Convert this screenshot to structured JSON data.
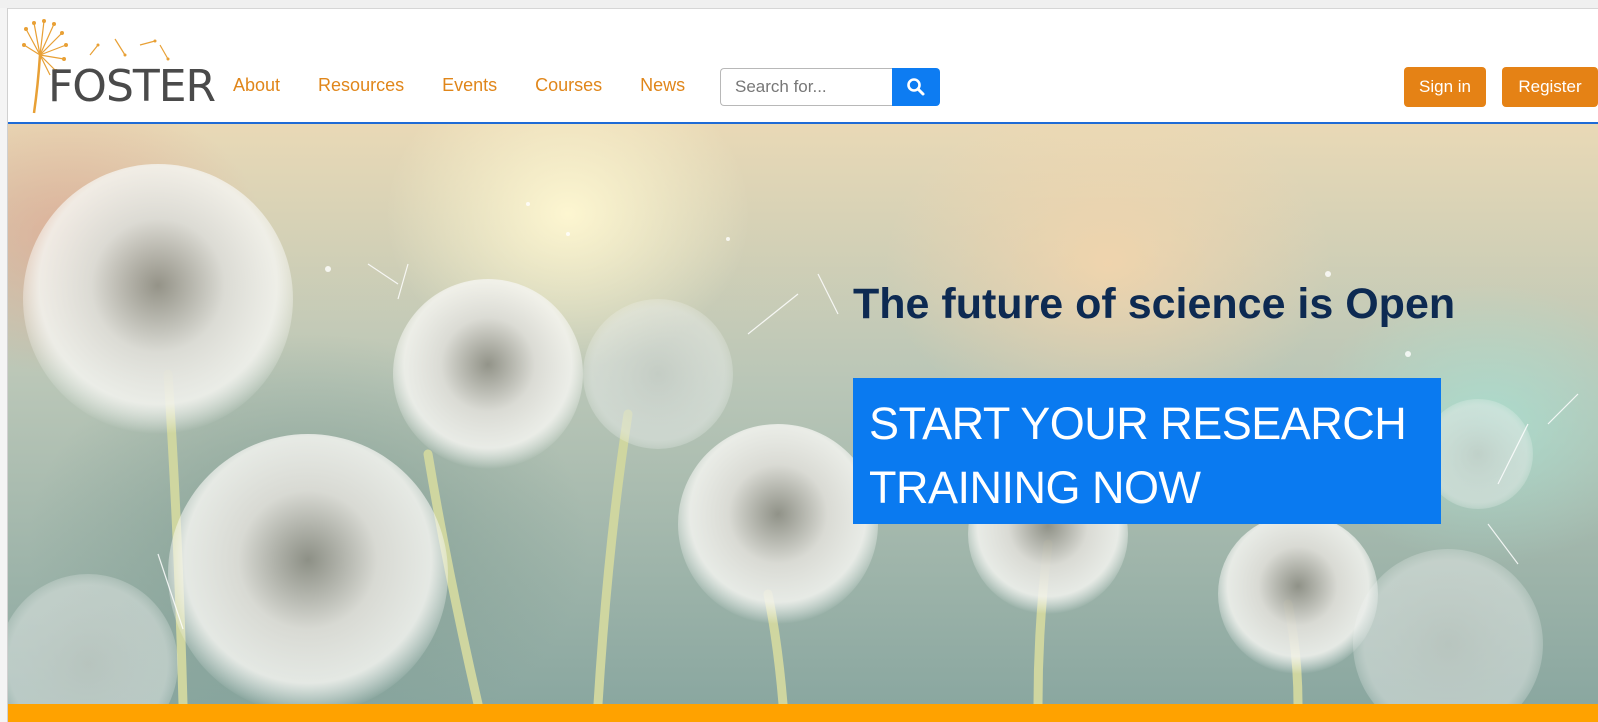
{
  "brand": {
    "logo_text": "FOSTER"
  },
  "nav": {
    "links": [
      {
        "label": "About"
      },
      {
        "label": "Resources"
      },
      {
        "label": "Events"
      },
      {
        "label": "Courses"
      },
      {
        "label": "News"
      }
    ]
  },
  "search": {
    "placeholder": "Search for...",
    "icon": "search-icon"
  },
  "auth": {
    "sign_in": "Sign in",
    "register": "Register"
  },
  "hero": {
    "title": "The future of science is Open",
    "cta_label": "START YOUR RESEARCH TRAINING NOW"
  },
  "colors": {
    "accent_orange": "#e58215",
    "primary_blue": "#0a7af0",
    "title_navy": "#0d2a52",
    "bottom_bar": "#ffa200"
  }
}
